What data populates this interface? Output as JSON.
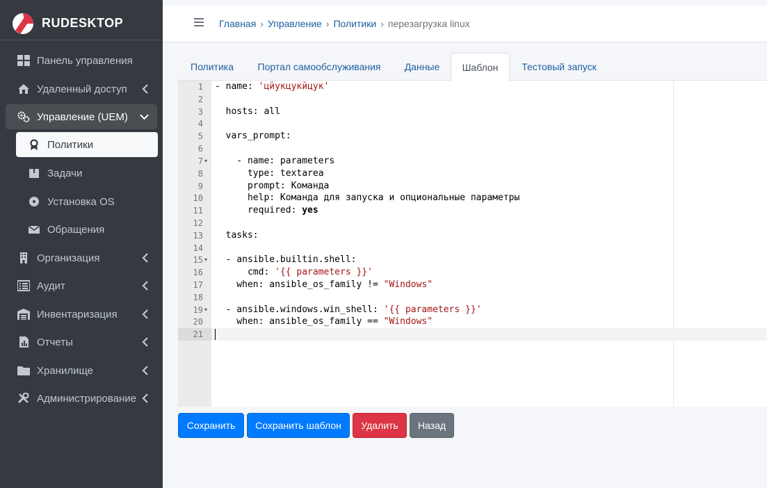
{
  "brand": {
    "name": "RUDESKTOP",
    "logo_icon": "rudesktop-logo"
  },
  "sidebar": {
    "items": [
      {
        "label": "Панель управления",
        "icon": "dashboard-icon"
      },
      {
        "label": "Удаленный доступ",
        "icon": "remote-access-icon"
      },
      {
        "label": "Управление (UEM)",
        "icon": "gears-icon"
      },
      {
        "label": "Организация",
        "icon": "building-icon"
      },
      {
        "label": "Аудит",
        "icon": "list-icon"
      },
      {
        "label": "Инвентаризация",
        "icon": "warehouse-icon"
      },
      {
        "label": "Отчеты",
        "icon": "report-icon"
      },
      {
        "label": "Хранилище",
        "icon": "folder-icon"
      },
      {
        "label": "Администрирование",
        "icon": "tools-icon"
      }
    ],
    "subitems": [
      {
        "label": "Политики",
        "icon": "award-icon"
      },
      {
        "label": "Задачи",
        "icon": "box-icon"
      },
      {
        "label": "Установка OS",
        "icon": "disc-icon"
      },
      {
        "label": "Обращения",
        "icon": "envelope-icon"
      }
    ]
  },
  "breadcrumb": {
    "items": [
      "Главная",
      "Управление",
      "Политики"
    ],
    "separator": "›",
    "current": "перезагрузка linux"
  },
  "tabs": [
    {
      "label": "Политика"
    },
    {
      "label": "Портал самообслуживания"
    },
    {
      "label": "Данные"
    },
    {
      "label": "Шаблон"
    },
    {
      "label": "Тестовый запуск"
    }
  ],
  "editor": {
    "lines": [
      "1",
      "2",
      "3",
      "4",
      "5",
      "6",
      "7",
      "8",
      "9",
      "10",
      "11",
      "12",
      "13",
      "14",
      "15",
      "16",
      "17",
      "18",
      "19",
      "20",
      "21"
    ],
    "code": {
      "l1": {
        "a": "- name: ",
        "b": "'цйукцукйцук'"
      },
      "l3": "  hosts: all",
      "l5": "  vars_prompt:",
      "l7": "    - name: parameters",
      "l8": "      type: textarea",
      "l9": "      prompt: Команда",
      "l10": "      help: Команда для запуска и опциональные параметры",
      "l11": {
        "a": "      required: ",
        "b": "yes"
      },
      "l13": "  tasks:",
      "l15": "  - ansible.builtin.shell:",
      "l16": {
        "a": "      cmd: ",
        "b": "'{{ parameters }}'"
      },
      "l17": {
        "a": "    when: ansible_os_family != ",
        "b": "\"Windows\""
      },
      "l19": {
        "a": "  - ansible.windows.win_shell: ",
        "b": "'{{ parameters }}'"
      },
      "l20": {
        "a": "    when: ansible_os_family == ",
        "b": "\"Windows\""
      }
    },
    "fold_marker": "▾"
  },
  "buttons": {
    "save": "Сохранить",
    "save_template": "Сохранить шаблон",
    "delete": "Удалить",
    "back": "Назад"
  },
  "colors": {
    "primary": "#007bff",
    "danger": "#dc3545",
    "secondary": "#6c757d",
    "sidebar": "#343a40"
  }
}
